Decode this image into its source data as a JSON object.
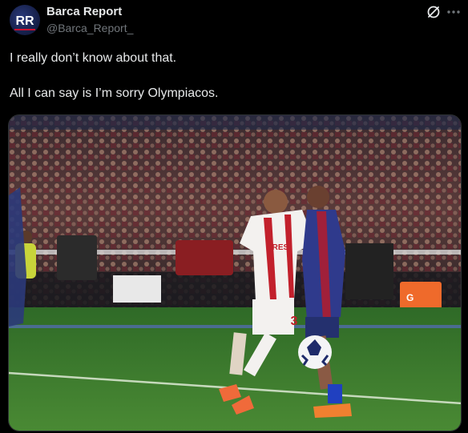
{
  "author": {
    "avatar_text": "RR",
    "display_name": "Barca Report",
    "handle": "@Barca_Report_"
  },
  "icons": {
    "grok": "grok-icon",
    "more": "more-options-icon"
  },
  "post": {
    "lines": [
      "I really don’t know about that.",
      "All I can say is I’m sorry Olympiacos."
    ]
  },
  "media": {
    "shirt_number": "3",
    "sponsor_text": "GRES",
    "cooler_text": "G"
  },
  "colors": {
    "background": "#000000",
    "text": "#e7e9ea",
    "muted": "#71767b",
    "pitch": "#3e7a2c"
  }
}
